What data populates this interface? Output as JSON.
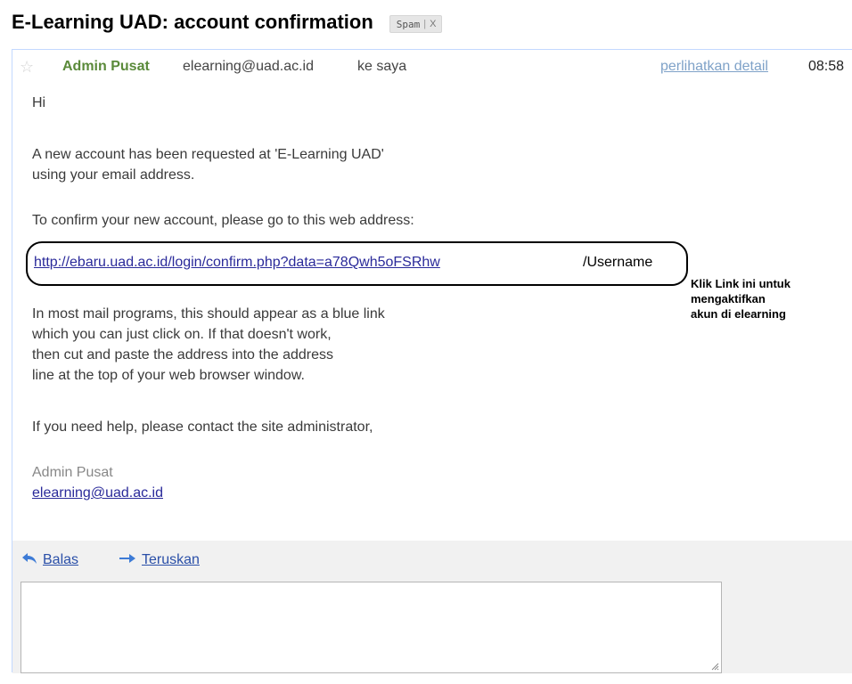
{
  "email": {
    "subject": "E-Learning UAD: account confirmation",
    "label": "Spam",
    "label_remove": "X",
    "label_separator": "|",
    "sender_name": "Admin Pusat",
    "sender_email": "elearning@uad.ac.id",
    "recipient": "ke saya",
    "show_details": "perlihatkan detail",
    "time": "08:58"
  },
  "body": {
    "greeting": "Hi",
    "para1_line1": "A new account has been requested at 'E-Learning UAD'",
    "para1_line2": "using your email address.",
    "para2": "To confirm your new account, please go to this web address:",
    "confirm_link": "http://ebaru.uad.ac.id/login/confirm.php?data=a78Qwh5oFSRhw",
    "username_suffix": "/Username",
    "para3_line1": "In most mail programs, this should appear as a blue link",
    "para3_line2": "which you can just click on. If that doesn't work,",
    "para3_line3": "then cut and paste the address into the address",
    "para3_line4": "line at the top of your web browser window.",
    "para4": "If you need help, please contact the site administrator,",
    "signature_name": "Admin Pusat",
    "signature_email": "elearning@uad.ac.id"
  },
  "annotation": {
    "line1": "Klik Link ini untuk",
    "line2": "mengaktifkan",
    "line3": "akun di elearning"
  },
  "reply": {
    "reply_label": "Balas",
    "forward_label": "Teruskan",
    "reply_value": ""
  },
  "icons": {
    "star": "star-icon",
    "reply": "reply-arrow-icon",
    "forward": "forward-arrow-icon"
  }
}
